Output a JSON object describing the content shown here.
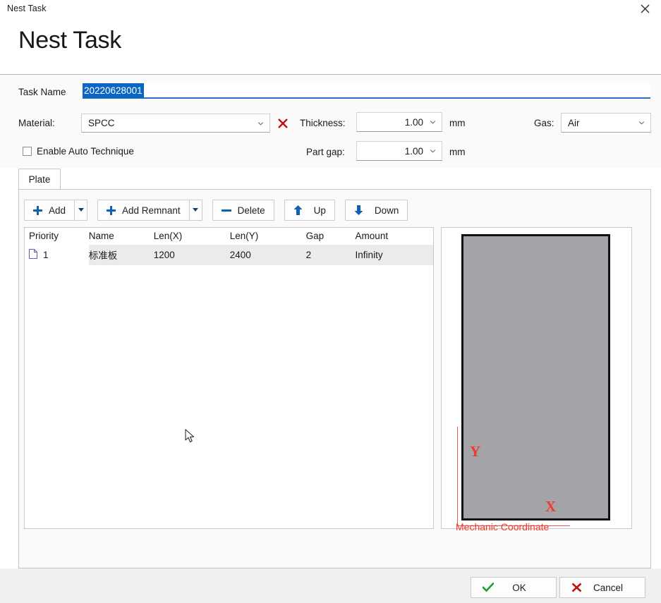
{
  "window": {
    "titlebar_text": "Nest Task",
    "close_icon": "close-icon"
  },
  "header": {
    "title": "Nest Task"
  },
  "form": {
    "task_name_label": "Task Name",
    "task_name_value": "20220628001",
    "material_label": "Material:",
    "material_value": "SPCC",
    "material_delete_icon": "red-x-icon",
    "thickness_label": "Thickness:",
    "thickness_value": "1.00",
    "thickness_unit": "mm",
    "gas_label": "Gas:",
    "gas_value": "Air",
    "auto_technique_label": "Enable Auto Technique",
    "auto_technique_checked": false,
    "part_gap_label": "Part gap:",
    "part_gap_value": "1.00",
    "part_gap_unit": "mm"
  },
  "tabs": [
    {
      "label": "Plate",
      "active": true
    }
  ],
  "toolbar": {
    "add_label": "Add",
    "add_remnant_label": "Add Remnant",
    "delete_label": "Delete",
    "up_label": "Up",
    "down_label": "Down"
  },
  "table": {
    "columns": [
      "Priority",
      "Name",
      "Len(X)",
      "Len(Y)",
      "Gap",
      "Amount"
    ],
    "rows": [
      {
        "priority": "1",
        "name": "标准板",
        "len_x": "1200",
        "len_y": "2400",
        "gap": "2",
        "amount": "Infinity"
      }
    ]
  },
  "preview": {
    "axis_y_label": "Y",
    "axis_x_label": "X",
    "coordinate_caption": "Mechanic Coordinate",
    "plate_fill_color": "#a3a3a8",
    "axis_color": "#f4382b"
  },
  "footer": {
    "ok_label": "OK",
    "cancel_label": "Cancel"
  }
}
